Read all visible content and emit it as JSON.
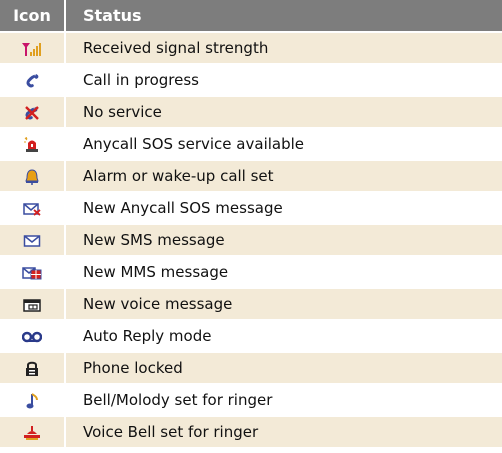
{
  "header": {
    "icon": "Icon",
    "status": "Status"
  },
  "rows": [
    {
      "icon": "signal-strength-icon",
      "label": "Received signal strength"
    },
    {
      "icon": "call-in-progress-icon",
      "label": "Call in progress"
    },
    {
      "icon": "no-service-icon",
      "label": "No service"
    },
    {
      "icon": "sos-service-icon",
      "label": "Anycall SOS service available"
    },
    {
      "icon": "alarm-bell-icon",
      "label": "Alarm or wake-up call set"
    },
    {
      "icon": "sos-message-icon",
      "label": "New Anycall SOS message"
    },
    {
      "icon": "sms-envelope-icon",
      "label": "New SMS message"
    },
    {
      "icon": "mms-message-icon",
      "label": "New MMS message"
    },
    {
      "icon": "voice-message-icon",
      "label": "New voice message"
    },
    {
      "icon": "auto-reply-icon",
      "label": "Auto Reply mode"
    },
    {
      "icon": "padlock-icon",
      "label": "Phone locked"
    },
    {
      "icon": "music-note-icon",
      "label": "Bell/Molody set for ringer"
    },
    {
      "icon": "voice-bell-icon",
      "label": "Voice Bell set for ringer"
    }
  ],
  "colors": {
    "header_bg": "#7d7d7d",
    "row_shade": "#f3ead7"
  }
}
